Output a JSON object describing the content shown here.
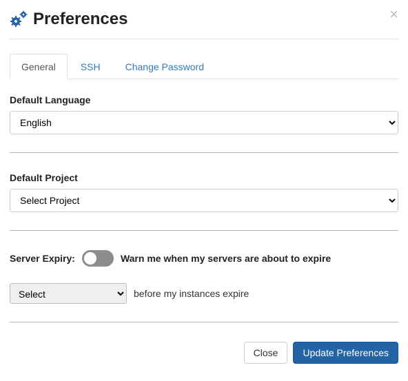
{
  "header": {
    "title": "Preferences",
    "close_glyph": "×"
  },
  "tabs": {
    "general": "General",
    "ssh": "SSH",
    "change_password": "Change Password"
  },
  "language": {
    "label": "Default Language",
    "value": "English"
  },
  "project": {
    "label": "Default Project",
    "value": "Select Project"
  },
  "expiry": {
    "label": "Server Expiry:",
    "warn_text": "Warn me when my servers are about to expire",
    "select_value": "Select",
    "suffix": "before my instances expire"
  },
  "footer": {
    "close": "Close",
    "update": "Update Preferences"
  }
}
